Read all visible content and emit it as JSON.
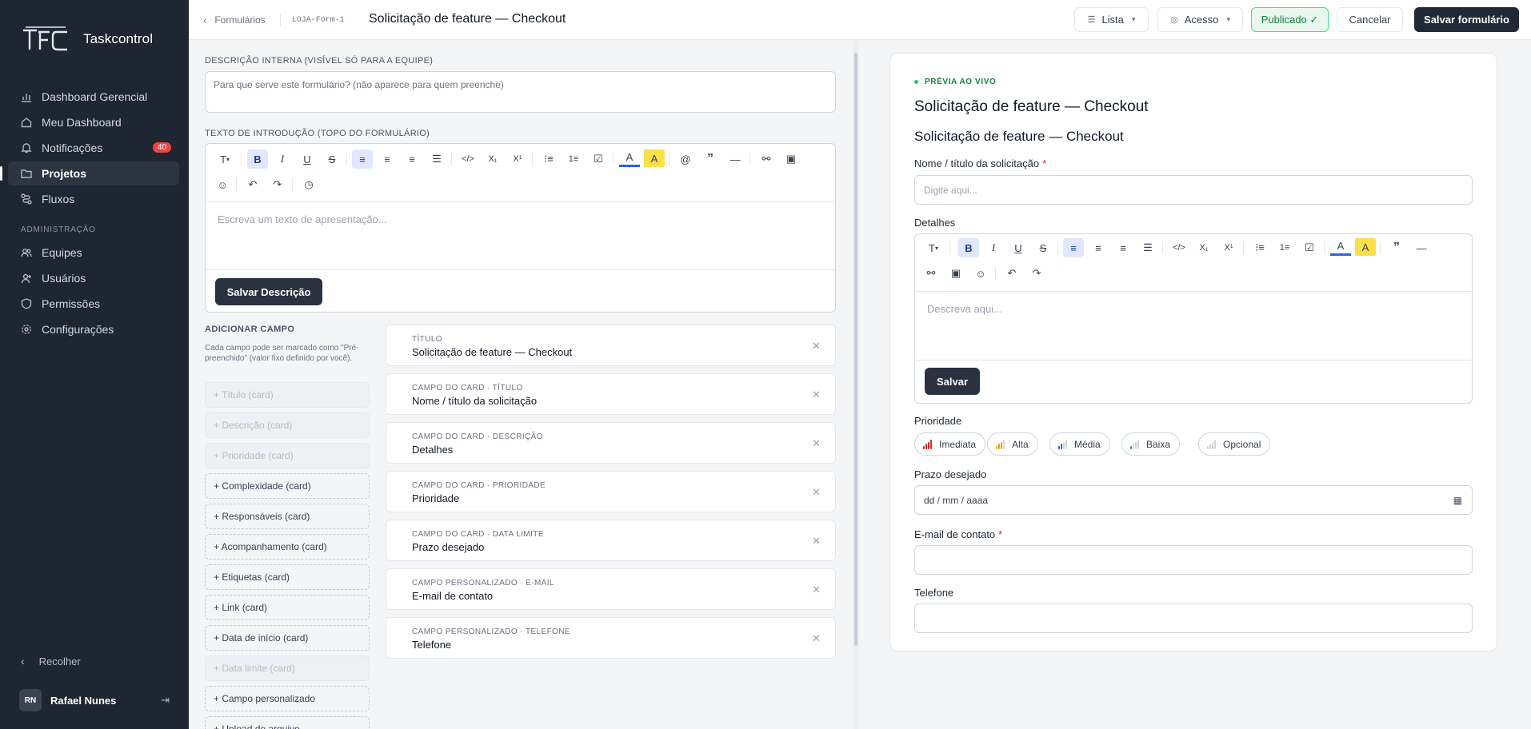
{
  "sidebar": {
    "app_name": "Taskcontrol",
    "items": [
      {
        "label": "Dashboard Gerencial",
        "icon": "bar-chart-icon"
      },
      {
        "label": "Meu Dashboard",
        "icon": "home-icon"
      },
      {
        "label": "Notificações",
        "icon": "bell-icon",
        "badge": "40"
      },
      {
        "label": "Projetos",
        "icon": "folder-icon",
        "active": true
      },
      {
        "label": "Fluxos",
        "icon": "flow-icon"
      }
    ],
    "section_label": "ADMINISTRAÇÃO",
    "admin_items": [
      {
        "label": "Equipes",
        "icon": "users-icon"
      },
      {
        "label": "Usuários",
        "icon": "user-icon"
      },
      {
        "label": "Permissões",
        "icon": "shield-icon"
      },
      {
        "label": "Configurações",
        "icon": "gear-icon"
      }
    ],
    "collapse_label": "Recolher",
    "user": {
      "initials": "RN",
      "name": "Rafael Nunes"
    }
  },
  "header": {
    "back_label": "Formulários",
    "form_code": "LOJA-Form-1",
    "title": "Solicitação de feature — Checkout",
    "view_label": "Lista",
    "access_label": "Acesso",
    "published_label": "Publicado ✓",
    "cancel_label": "Cancelar",
    "save_label": "Salvar formulário"
  },
  "editor": {
    "internal_desc_label": "DESCRIÇÃO INTERNA (VISÍVEL SÓ PARA A EQUIPE)",
    "internal_desc_placeholder": "Para que serve este formulário? (não aparece para quem preenche)",
    "intro_label": "TEXTO DE INTRODUÇÃO (TOPO DO FORMULÁRIO)",
    "intro_placeholder": "Escreva um texto de apresentação...",
    "save_desc_label": "Salvar Descrição",
    "add_field_title": "ADICIONAR CAMPO",
    "add_field_help": "Cada campo pode ser marcado como \"Pré-preenchido\" (valor fixo definido por você).",
    "add_buttons": [
      {
        "label": "+ Título (card)",
        "disabled": true
      },
      {
        "label": "+ Descrição (card)",
        "disabled": true
      },
      {
        "label": "+ Prioridade (card)",
        "disabled": true
      },
      {
        "label": "+ Complexidade (card)",
        "disabled": false
      },
      {
        "label": "+ Responsáveis (card)",
        "disabled": false
      },
      {
        "label": "+ Acompanhamento (card)",
        "disabled": false
      },
      {
        "label": "+ Etiquetas (card)",
        "disabled": false
      },
      {
        "label": "+ Link (card)",
        "disabled": false
      },
      {
        "label": "+ Data de início (card)",
        "disabled": false
      },
      {
        "label": "+ Data limite (card)",
        "disabled": true
      },
      {
        "label": "+ Campo personalizado",
        "disabled": false
      },
      {
        "label": "+ Upload de arquivo",
        "disabled": false
      }
    ],
    "fields": [
      {
        "kind": "TÍTULO",
        "value": "Solicitação de feature — Checkout"
      },
      {
        "kind": "CAMPO DO CARD · TÍTULO",
        "value": "Nome / título da solicitação"
      },
      {
        "kind": "CAMPO DO CARD · DESCRIÇÃO",
        "value": "Detalhes"
      },
      {
        "kind": "CAMPO DO CARD · PRIORIDADE",
        "value": "Prioridade"
      },
      {
        "kind": "CAMPO DO CARD · DATA LIMITE",
        "value": "Prazo desejado"
      },
      {
        "kind": "CAMPO PERSONALIZADO · E-MAIL",
        "value": "E-mail de contato"
      },
      {
        "kind": "CAMPO PERSONALIZADO · TELEFONE",
        "value": "Telefone"
      }
    ]
  },
  "preview": {
    "live_label": "PRÉVIA AO VIVO",
    "title": "Solicitação de feature — Checkout",
    "form_title": "Solicitação de feature — Checkout",
    "name_label": "Nome / título da solicitação",
    "required_mark": "*",
    "name_placeholder": "Digite aqui...",
    "details_label": "Detalhes",
    "details_placeholder": "Descreva aqui...",
    "details_save": "Salvar",
    "priority_label": "Prioridade",
    "priorities": [
      {
        "label": "Imediata",
        "color": "#dc2626",
        "level": 4
      },
      {
        "label": "Alta",
        "color": "#f59e0b",
        "level": 3
      },
      {
        "label": "Média",
        "color": "#2563eb",
        "level": 2
      },
      {
        "label": "Baixa",
        "color": "#16a34a",
        "level": 1
      },
      {
        "label": "Opcional",
        "color": "#9ca3af",
        "level": 0
      }
    ],
    "deadline_label": "Prazo desejado",
    "date_placeholder": "dd / mm / aaaa",
    "email_label": "E-mail de contato",
    "phone_label": "Telefone"
  },
  "colors": {
    "sidebar_bg": "#1f2633",
    "accent_dark": "#1f2937",
    "published_green": "#15803d",
    "badge_red": "#ef4444"
  }
}
